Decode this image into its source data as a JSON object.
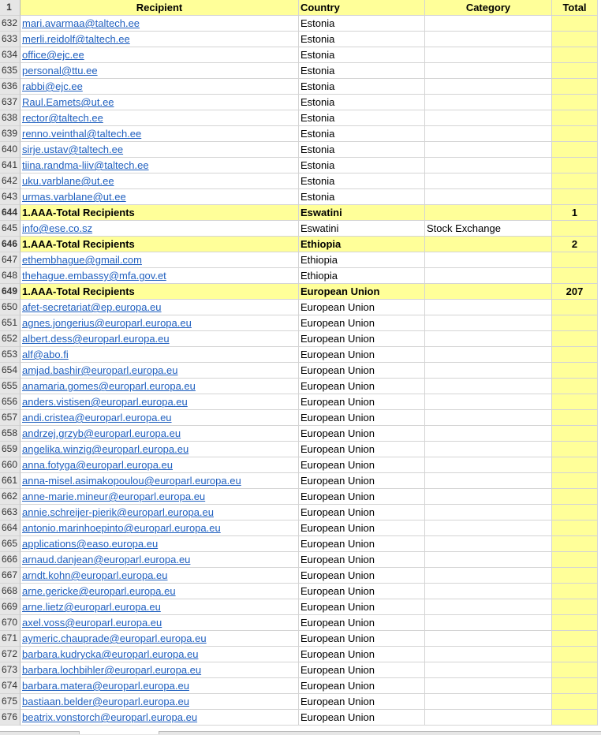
{
  "header": {
    "row": "1",
    "recipient": "Recipient",
    "country": "Country",
    "category": "Category",
    "total": "Total"
  },
  "rows": [
    {
      "n": "632",
      "r": "mari.avarmaa@taltech.ee",
      "c": "Estonia",
      "cat": "",
      "t": ""
    },
    {
      "n": "633",
      "r": "merli.reidolf@taltech.ee",
      "c": "Estonia",
      "cat": "",
      "t": ""
    },
    {
      "n": "634",
      "r": "office@ejc.ee",
      "c": "Estonia",
      "cat": "",
      "t": ""
    },
    {
      "n": "635",
      "r": "personal@ttu.ee",
      "c": "Estonia",
      "cat": "",
      "t": ""
    },
    {
      "n": "636",
      "r": "rabbi@ejc.ee",
      "c": "Estonia",
      "cat": "",
      "t": ""
    },
    {
      "n": "637",
      "r": "Raul.Eamets@ut.ee",
      "c": "Estonia",
      "cat": "",
      "t": ""
    },
    {
      "n": "638",
      "r": "rector@taltech.ee",
      "c": "Estonia",
      "cat": "",
      "t": ""
    },
    {
      "n": "639",
      "r": "renno.veinthal@taltech.ee",
      "c": "Estonia",
      "cat": "",
      "t": ""
    },
    {
      "n": "640",
      "r": "sirje.ustav@taltech.ee",
      "c": "Estonia",
      "cat": "",
      "t": ""
    },
    {
      "n": "641",
      "r": "tiina.randma-liiv@taltech.ee",
      "c": "Estonia",
      "cat": "",
      "t": ""
    },
    {
      "n": "642",
      "r": "uku.varblane@ut.ee",
      "c": "Estonia",
      "cat": "",
      "t": ""
    },
    {
      "n": "643",
      "r": "urmas.varblane@ut.ee",
      "c": "Estonia",
      "cat": "",
      "t": ""
    },
    {
      "n": "644",
      "r": "1.AAA-Total Recipients",
      "c": "Eswatini",
      "cat": "",
      "t": "1",
      "total": true
    },
    {
      "n": "645",
      "r": "info@ese.co.sz",
      "c": "Eswatini",
      "cat": "Stock Exchange",
      "t": ""
    },
    {
      "n": "646",
      "r": "1.AAA-Total Recipients",
      "c": "Ethiopia",
      "cat": "",
      "t": "2",
      "total": true
    },
    {
      "n": "647",
      "r": "ethembhague@gmail.com",
      "c": "Ethiopia",
      "cat": "",
      "t": ""
    },
    {
      "n": "648",
      "r": "thehague.embassy@mfa.gov.et",
      "c": "Ethiopia",
      "cat": "",
      "t": ""
    },
    {
      "n": "649",
      "r": "1.AAA-Total Recipients",
      "c": "European Union",
      "cat": "",
      "t": "207",
      "total": true
    },
    {
      "n": "650",
      "r": "afet-secretariat@ep.europa.eu",
      "c": "European Union",
      "cat": "",
      "t": ""
    },
    {
      "n": "651",
      "r": "agnes.jongerius@europarl.europa.eu",
      "c": "European Union",
      "cat": "",
      "t": ""
    },
    {
      "n": "652",
      "r": "albert.dess@europarl.europa.eu",
      "c": "European Union",
      "cat": "",
      "t": ""
    },
    {
      "n": "653",
      "r": "alf@abo.fi",
      "c": "European Union",
      "cat": "",
      "t": ""
    },
    {
      "n": "654",
      "r": "amjad.bashir@europarl.europa.eu",
      "c": "European Union",
      "cat": "",
      "t": ""
    },
    {
      "n": "655",
      "r": "anamaria.gomes@europarl.europa.eu",
      "c": "European Union",
      "cat": "",
      "t": ""
    },
    {
      "n": "656",
      "r": "anders.vistisen@europarl.europa.eu",
      "c": "European Union",
      "cat": "",
      "t": ""
    },
    {
      "n": "657",
      "r": "andi.cristea@europarl.europa.eu",
      "c": "European Union",
      "cat": "",
      "t": ""
    },
    {
      "n": "658",
      "r": "andrzej.grzyb@europarl.europa.eu",
      "c": "European Union",
      "cat": "",
      "t": ""
    },
    {
      "n": "659",
      "r": "angelika.winzig@europarl.europa.eu",
      "c": "European Union",
      "cat": "",
      "t": ""
    },
    {
      "n": "660",
      "r": "anna.fotyga@europarl.europa.eu",
      "c": "European Union",
      "cat": "",
      "t": ""
    },
    {
      "n": "661",
      "r": "anna-misel.asimakopoulou@europarl.europa.eu",
      "c": "European Union",
      "cat": "",
      "t": ""
    },
    {
      "n": "662",
      "r": "anne-marie.mineur@europarl.europa.eu",
      "c": "European Union",
      "cat": "",
      "t": ""
    },
    {
      "n": "663",
      "r": "annie.schreijer-pierik@europarl.europa.eu",
      "c": "European Union",
      "cat": "",
      "t": ""
    },
    {
      "n": "664",
      "r": "antonio.marinhoepinto@europarl.europa.eu",
      "c": "European Union",
      "cat": "",
      "t": ""
    },
    {
      "n": "665",
      "r": "applications@easo.europa.eu",
      "c": "European Union",
      "cat": "",
      "t": ""
    },
    {
      "n": "666",
      "r": "arnaud.danjean@europarl.europa.eu",
      "c": "European Union",
      "cat": "",
      "t": ""
    },
    {
      "n": "667",
      "r": "arndt.kohn@europarl.europa.eu",
      "c": "European Union",
      "cat": "",
      "t": ""
    },
    {
      "n": "668",
      "r": "arne.gericke@europarl.europa.eu",
      "c": "European Union",
      "cat": "",
      "t": ""
    },
    {
      "n": "669",
      "r": "arne.lietz@europarl.europa.eu",
      "c": "European Union",
      "cat": "",
      "t": ""
    },
    {
      "n": "670",
      "r": "axel.voss@europarl.europa.eu",
      "c": "European Union",
      "cat": "",
      "t": ""
    },
    {
      "n": "671",
      "r": "aymeric.chauprade@europarl.europa.eu",
      "c": "European Union",
      "cat": "",
      "t": ""
    },
    {
      "n": "672",
      "r": "barbara.kudrycka@europarl.europa.eu",
      "c": "European Union",
      "cat": "",
      "t": ""
    },
    {
      "n": "673",
      "r": "barbara.lochbihler@europarl.europa.eu",
      "c": "European Union",
      "cat": "",
      "t": ""
    },
    {
      "n": "674",
      "r": "barbara.matera@europarl.europa.eu",
      "c": "European Union",
      "cat": "",
      "t": ""
    },
    {
      "n": "675",
      "r": "bastiaan.belder@europarl.europa.eu",
      "c": "European Union",
      "cat": "",
      "t": ""
    },
    {
      "n": "676",
      "r": "beatrix.vonstorch@europarl.europa.eu",
      "c": "European Union",
      "cat": "",
      "t": ""
    }
  ]
}
